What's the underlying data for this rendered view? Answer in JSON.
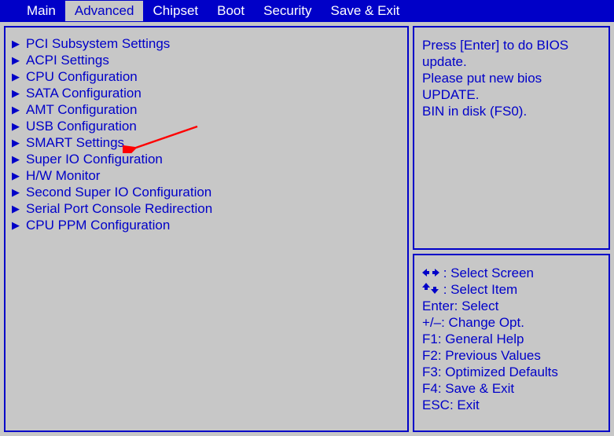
{
  "tabs": {
    "main": "Main",
    "advanced": "Advanced",
    "chipset": "Chipset",
    "boot": "Boot",
    "security": "Security",
    "save_exit": "Save & Exit"
  },
  "menu_items": [
    "PCI Subsystem Settings",
    "ACPI Settings",
    "CPU Configuration",
    "SATA Configuration",
    "AMT Configuration",
    "USB Configuration",
    "SMART Settings",
    "Super IO Configuration",
    "H/W Monitor",
    "Second Super IO Configuration",
    "Serial Port Console Redirection",
    "CPU PPM Configuration"
  ],
  "help": {
    "line1": "Press [Enter] to do BIOS",
    "line2": "update.",
    "line3": "Please put new bios UPDATE.",
    "line4": "BIN in disk (FS0)."
  },
  "keys": {
    "select_screen": ": Select Screen",
    "select_item": ": Select Item",
    "enter": "Enter: Select",
    "change_opt": "+/–: Change Opt.",
    "f1": "F1: General Help",
    "f2": "F2: Previous Values",
    "f3": "F3: Optimized Defaults",
    "f4": "F4: Save & Exit",
    "esc": "ESC: Exit"
  }
}
